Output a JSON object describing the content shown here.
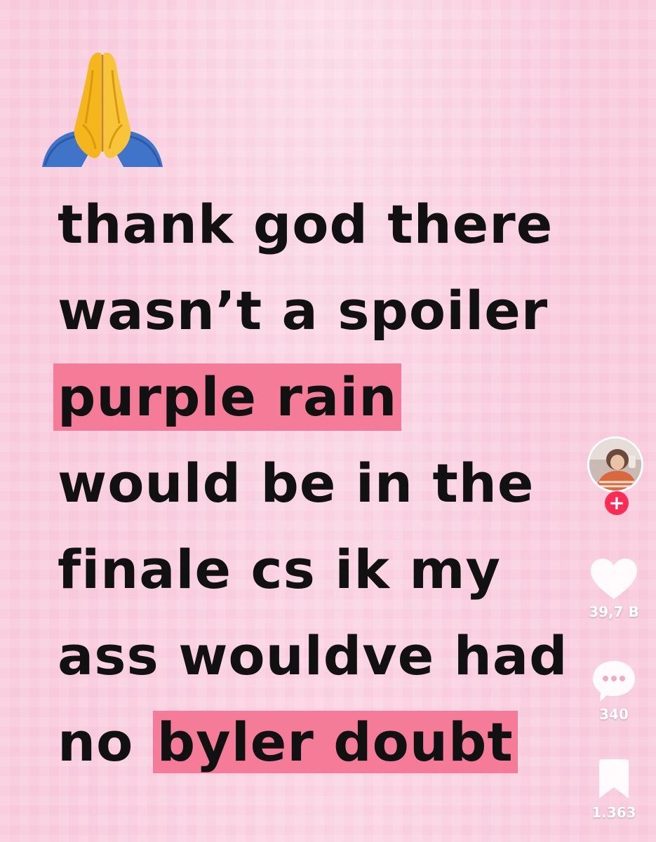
{
  "post": {
    "emoji": {
      "icon": "folded-hands-icon"
    },
    "caption_lines": [
      {
        "segments": [
          {
            "text": "thank god there",
            "highlight": false
          }
        ]
      },
      {
        "segments": [
          {
            "text": "wasn’t a spoiler",
            "highlight": false
          }
        ]
      },
      {
        "segments": [
          {
            "text": "purple rain",
            "highlight": true
          }
        ]
      },
      {
        "segments": [
          {
            "text": "would be in the",
            "highlight": false
          }
        ]
      },
      {
        "segments": [
          {
            "text": "finale cs ik my",
            "highlight": false
          }
        ]
      },
      {
        "segments": [
          {
            "text": "ass wouldve had",
            "highlight": false
          }
        ]
      },
      {
        "segments": [
          {
            "text": "no ",
            "highlight": false
          },
          {
            "text": "byler doubt",
            "highlight": true
          }
        ]
      }
    ],
    "highlight_color": "#f57c98",
    "background_color": "#f8c8db"
  },
  "actions": {
    "avatar": {
      "icon": "user-avatar",
      "follow_symbol": "+",
      "follow_color": "#fe2c55"
    },
    "like": {
      "icon": "heart-icon",
      "count": "39,7 B"
    },
    "comment": {
      "icon": "comment-bubble-icon",
      "count": "340"
    },
    "save": {
      "icon": "bookmark-icon",
      "count": "1.363"
    }
  }
}
